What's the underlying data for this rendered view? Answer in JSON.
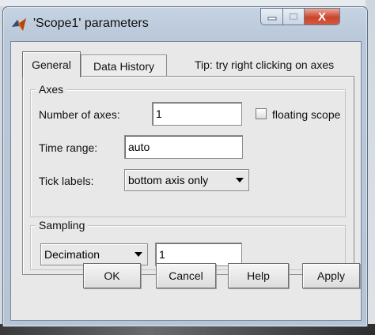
{
  "window": {
    "title": "'Scope1' parameters",
    "close_glyph": "X"
  },
  "tabs": [
    {
      "label": "General",
      "selected": true
    },
    {
      "label": "Data History",
      "selected": false
    }
  ],
  "tip": "Tip: try right clicking on axes",
  "axes_group": {
    "legend": "Axes",
    "number_of_axes_label": "Number of axes:",
    "number_of_axes_value": "1",
    "floating_scope_label": "floating scope",
    "floating_scope_checked": false,
    "time_range_label": "Time range:",
    "time_range_value": "auto",
    "tick_labels_label": "Tick labels:",
    "tick_labels_value": "bottom axis only"
  },
  "sampling_group": {
    "legend": "Sampling",
    "mode_value": "Decimation",
    "factor_value": "1"
  },
  "buttons": {
    "ok": "OK",
    "cancel": "Cancel",
    "help": "Help",
    "apply": "Apply"
  },
  "icons": {
    "app": "matlab-logo-icon",
    "dropdown": "chevron-down-icon"
  }
}
